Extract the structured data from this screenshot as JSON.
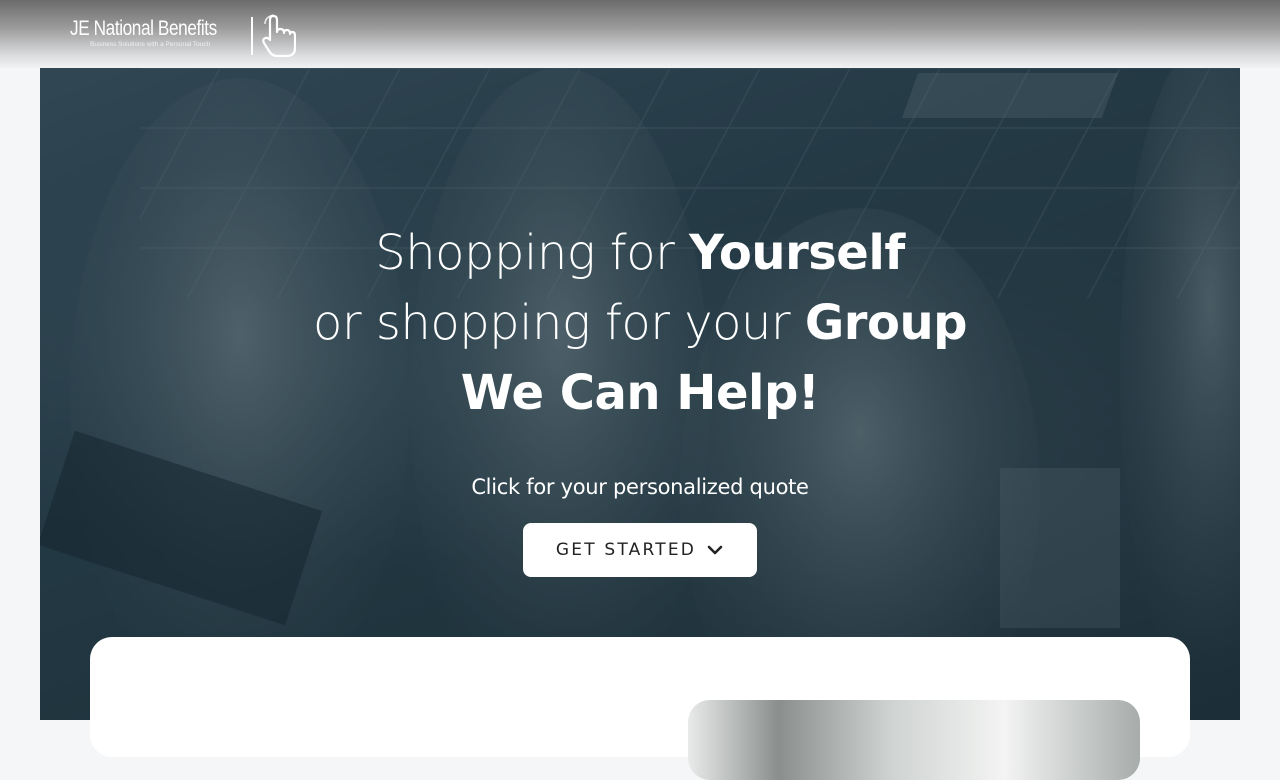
{
  "brand": {
    "name": "JE National Benefits",
    "tagline": "Business Solutions with a Personal Touch",
    "icon": "pointing-hand-icon"
  },
  "hero": {
    "line1_regular": "Shopping for ",
    "line1_bold": "Yourself",
    "line2_regular": "or shopping for your ",
    "line2_bold": "Group",
    "line3_bold": "We Can Help!",
    "subtext": "Click for your personalized quote",
    "cta_label": "GET STARTED",
    "cta_icon": "chevron-down-icon"
  },
  "colors": {
    "overlay": "#1b323c",
    "cta_background": "#ffffff",
    "card_background": "#ffffff",
    "page_background": "#f4f6f8"
  }
}
